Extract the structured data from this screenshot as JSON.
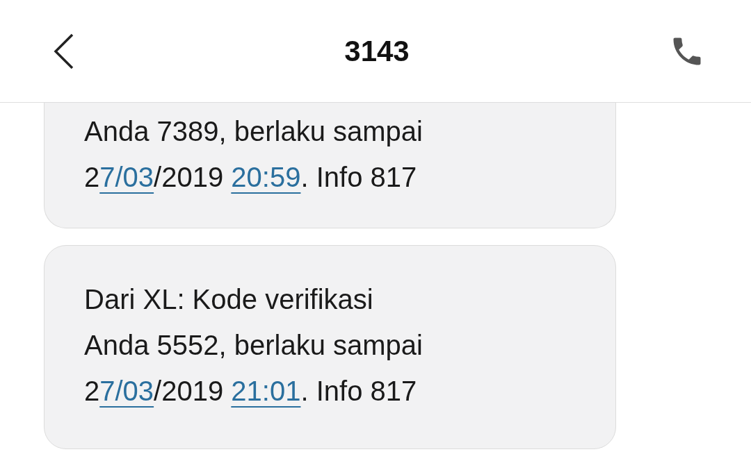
{
  "header": {
    "title": "3143"
  },
  "messages": [
    {
      "lines": [
        [
          {
            "kind": "text",
            "text": "Anda 7389, berlaku sampai"
          }
        ],
        [
          {
            "kind": "text",
            "text": "2"
          },
          {
            "kind": "link",
            "text": "7/03"
          },
          {
            "kind": "text",
            "text": "/2019 "
          },
          {
            "kind": "link",
            "text": "20:59"
          },
          {
            "kind": "text",
            "text": ". Info 817"
          }
        ]
      ]
    },
    {
      "lines": [
        [
          {
            "kind": "text",
            "text": "Dari XL: Kode verifikasi"
          }
        ],
        [
          {
            "kind": "text",
            "text": "Anda 5552, berlaku sampai"
          }
        ],
        [
          {
            "kind": "text",
            "text": "2"
          },
          {
            "kind": "link",
            "text": "7/03"
          },
          {
            "kind": "text",
            "text": "/2019 "
          },
          {
            "kind": "link",
            "text": "21:01"
          },
          {
            "kind": "text",
            "text": ". Info 817"
          }
        ]
      ]
    }
  ]
}
